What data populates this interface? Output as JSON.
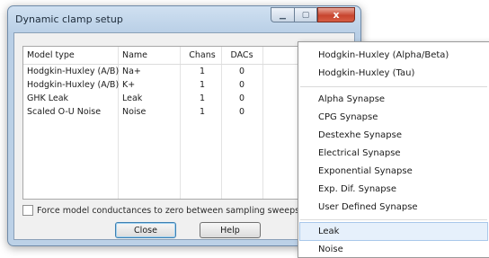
{
  "window": {
    "title": "Dynamic clamp setup",
    "minimize_icon": "minimize-icon",
    "maximize_icon": "maximize-icon",
    "close_icon": "close-icon",
    "close_glyph": "x"
  },
  "table": {
    "headers": [
      "Model type",
      "Name",
      "Chans",
      "DACs"
    ],
    "rows": [
      [
        "Hodgkin-Huxley (A/B)",
        "Na+",
        "1",
        "0"
      ],
      [
        "Hodgkin-Huxley (A/B)",
        "K+",
        "1",
        "0"
      ],
      [
        "GHK Leak",
        "Leak",
        "1",
        "0"
      ],
      [
        "Scaled O-U Noise",
        "Noise",
        "1",
        "0"
      ]
    ]
  },
  "options": {
    "force_zero_label": "Force model conductances to zero between sampling sweeps",
    "force_zero_checked": false
  },
  "buttons": {
    "close": "Close",
    "help": "Help"
  },
  "menu": {
    "groups": [
      [
        "Hodgkin-Huxley (Alpha/Beta)",
        "Hodgkin-Huxley (Tau)"
      ],
      [
        "Alpha Synapse",
        "CPG Synapse",
        "Destexhe Synapse",
        "Electrical Synapse",
        "Exponential Synapse",
        "Exp. Dif. Synapse",
        "User Defined Synapse"
      ],
      [
        "Leak",
        "Noise"
      ]
    ],
    "highlighted": "Leak"
  }
}
